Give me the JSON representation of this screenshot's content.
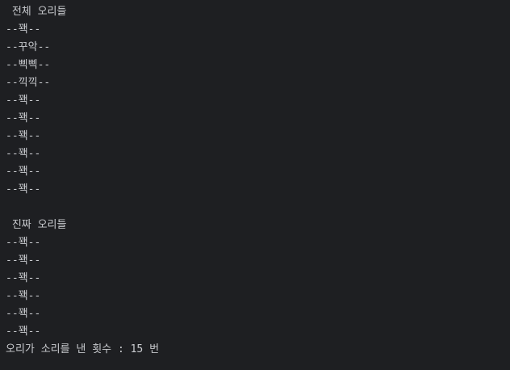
{
  "console": {
    "lines": [
      " 전체 오리들",
      "--꽥--",
      "--꾸악--",
      "--삑삑--",
      "--끽끽--",
      "--꽥--",
      "--꽥--",
      "--꽥--",
      "--꽥--",
      "--꽥--",
      "--꽥--",
      "",
      " 진짜 오리들",
      "--꽥--",
      "--꽥--",
      "--꽥--",
      "--꽥--",
      "--꽥--",
      "--꽥--",
      "오리가 소리를 낸 횟수 : 15 번"
    ]
  }
}
